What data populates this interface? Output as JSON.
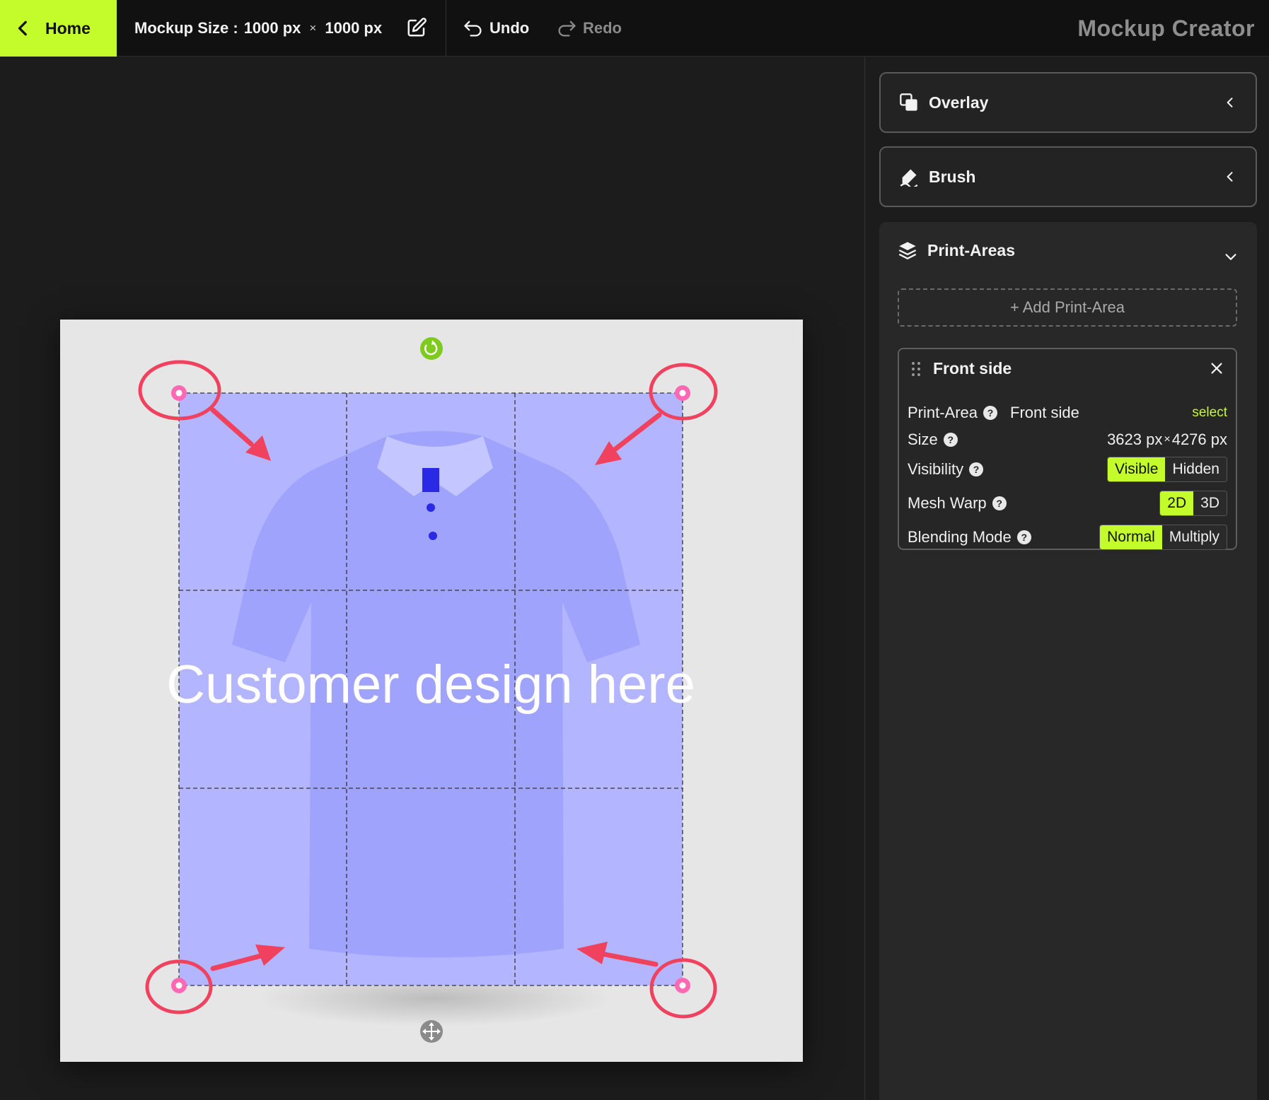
{
  "topbar": {
    "home_label": "Home",
    "mockup_size_label": "Mockup Size :",
    "mockup_width": "1000 px",
    "times": "×",
    "mockup_height": "1000 px",
    "undo_label": "Undo",
    "redo_label": "Redo",
    "app_title": "Mockup Creator"
  },
  "canvas": {
    "overlay_text": "Customer design here",
    "print_area_color": "#b3b5ff",
    "annotation_color": "#f0415e",
    "handle_color": "#ff69b4"
  },
  "panels": {
    "overlay": {
      "title": "Overlay"
    },
    "brush": {
      "title": "Brush"
    },
    "print_areas": {
      "title": "Print-Areas",
      "add_label": "+ Add Print-Area",
      "area": {
        "title": "Front side",
        "print_area_label": "Print-Area",
        "print_area_value": "Front side",
        "select_label": "select",
        "size_label": "Size",
        "size_width": "3623 px",
        "size_times": "×",
        "size_height": "4276 px",
        "visibility_label": "Visibility",
        "visibility_options": [
          "Visible",
          "Hidden"
        ],
        "visibility_selected": "Visible",
        "mesh_warp_label": "Mesh Warp",
        "mesh_warp_options": [
          "2D",
          "3D"
        ],
        "mesh_warp_selected": "2D",
        "blending_label": "Blending Mode",
        "blending_options": [
          "Normal",
          "Multiply"
        ],
        "blending_selected": "Normal"
      }
    }
  },
  "accent_color": "#c4fb2a"
}
